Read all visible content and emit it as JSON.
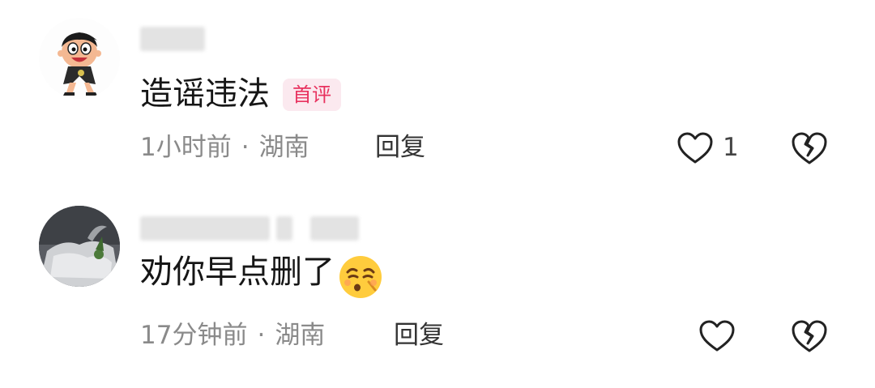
{
  "comments": [
    {
      "text": "造谣违法",
      "badge": "首评",
      "time": "1小时前",
      "separator": "·",
      "location": "湖南",
      "reply_label": "回复",
      "like_count": "1",
      "avatar_icon": "cartoon-character-avatar"
    },
    {
      "text": "劝你早点删了",
      "emoji_icon": "kissing-emoji",
      "time": "17分钟前",
      "separator": "·",
      "location": "湖南",
      "reply_label": "回复",
      "avatar_icon": "photo-avatar"
    }
  ],
  "colors": {
    "badge_text": "#e8325f",
    "badge_bg": "#fbe9ef",
    "meta_text": "#8a8a8a",
    "icon_stroke": "#222222"
  }
}
